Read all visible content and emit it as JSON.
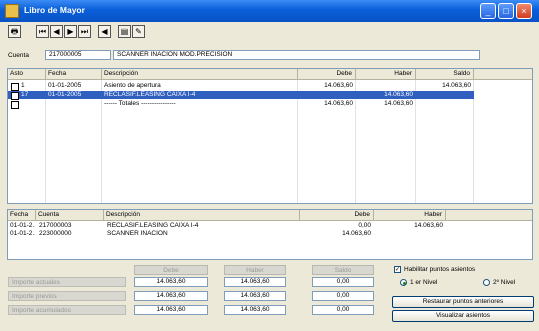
{
  "window": {
    "title": "Libro de Mayor",
    "controls": [
      "_",
      "□",
      "×"
    ]
  },
  "toolbar": {
    "buttons": [
      {
        "name": "print-icon",
        "glyph": "🖶"
      },
      {
        "name": "first-icon",
        "glyph": "⏮"
      },
      {
        "name": "prev-icon",
        "glyph": "◀"
      },
      {
        "name": "next-icon",
        "glyph": "▶"
      },
      {
        "name": "last-icon",
        "glyph": "⏭"
      },
      {
        "name": "back-icon",
        "glyph": "◀"
      },
      {
        "name": "chart-icon",
        "glyph": "▤"
      },
      {
        "name": "tool-icon",
        "glyph": "✎"
      }
    ]
  },
  "cuenta": {
    "label": "Cuenta",
    "code": "217000005",
    "name": "SCANNER INACION MOD.PRECISION"
  },
  "top_grid": {
    "headers": [
      "Asto",
      "Fecha",
      "Descripción",
      "Debe",
      "Haber",
      "Saldo"
    ],
    "rows": [
      {
        "asto": "1",
        "fecha": "01-01-2005",
        "desc": "Asiento de apertura",
        "debe": "14.063,60",
        "haber": "",
        "saldo": "14.063,60",
        "selected": false
      },
      {
        "asto": "17",
        "fecha": "01-01-2005",
        "desc": "RECLASIF.LEASING CAIXA I-4",
        "debe": "",
        "haber": "14.063,60",
        "saldo": "",
        "selected": true
      },
      {
        "asto": "",
        "fecha": "",
        "desc": "------ Totales ----------------",
        "debe": "14.063,60",
        "haber": "14.063,60",
        "saldo": "",
        "selected": false
      }
    ]
  },
  "bottom_grid": {
    "headers": [
      "Fecha",
      "Cuenta",
      "Descripción",
      "Debe",
      "Haber"
    ],
    "rows": [
      {
        "fecha": "01-01-2...",
        "cuenta": "217000003",
        "desc": "RECLASIF.LEASING CAIXA I-4",
        "debe": "0,00",
        "haber": "14.063,60"
      },
      {
        "fecha": "01-01-2...",
        "cuenta": "223000000",
        "desc": "SCANNER INACION",
        "debe": "14.063,60",
        "haber": ""
      }
    ]
  },
  "summary": {
    "col_headers": [
      "Debe",
      "Haber",
      "Saldo"
    ],
    "row_labels": [
      "Importe actuales",
      "Importe previos",
      "Importe acumulados"
    ],
    "values": [
      [
        "14.063,60",
        "14.063,60",
        "0,00"
      ],
      [
        "14.063,60",
        "14.063,60",
        "0,00"
      ],
      [
        "14.063,60",
        "14.063,60",
        "0,00"
      ]
    ]
  },
  "options": {
    "habilitar_label": "Habilitar puntos asientos",
    "habilitar_checked": true,
    "nivel1_label": "1 er Nivel",
    "nivel2_label": "2º Nivel",
    "nivel_selected": 1,
    "restaurar_label": "Restaurar puntos anteriores",
    "visualizar_label": "Visualizar asientos"
  }
}
